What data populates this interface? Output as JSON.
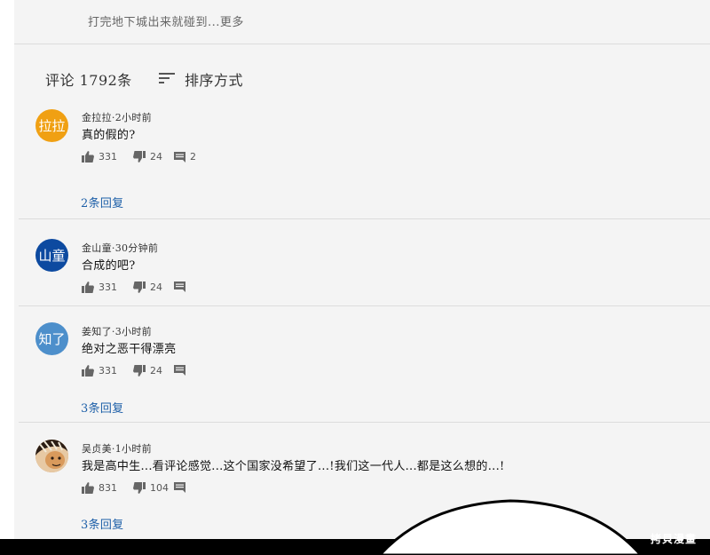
{
  "top": {
    "description": "打完地下城出来就碰到...更多"
  },
  "header": {
    "count_label": "评论 1792条",
    "sort_label": "排序方式",
    "sort_icon": "sort-icon"
  },
  "comments": [
    {
      "avatar_text": "拉拉",
      "avatar_color": "#f0a013",
      "meta": "金拉拉·2小时前",
      "text": "真的假的?",
      "likes": "331",
      "dislikes": "24",
      "reply_count": "2",
      "replies_link": "2条回复"
    },
    {
      "avatar_text": "山童",
      "avatar_color": "#0d4aa0",
      "meta": "金山童·30分钟前",
      "text": "合成的吧?",
      "likes": "331",
      "dislikes": "24",
      "reply_count": "",
      "replies_link": ""
    },
    {
      "avatar_text": "知了",
      "avatar_color": "#4d8fcb",
      "meta": "姜知了·3小时前",
      "text": "绝对之恶干得漂亮",
      "likes": "331",
      "dislikes": "24",
      "reply_count": "",
      "replies_link": "3条回复"
    },
    {
      "avatar_text": "",
      "avatar_color": "#c9894c",
      "meta": "吴贞美·1小时前",
      "text": "我是高中生...看评论感觉...这个国家没希望了...!我们这一代人...都是这么想的...!",
      "likes": "831",
      "dislikes": "104",
      "reply_count": "",
      "replies_link": "3条回复"
    }
  ],
  "watermark": "拷貝漫畫",
  "colors": {
    "panel_bg": "#f4f4f4",
    "link": "#1d5fa8",
    "divider": "#dcdcdc"
  }
}
